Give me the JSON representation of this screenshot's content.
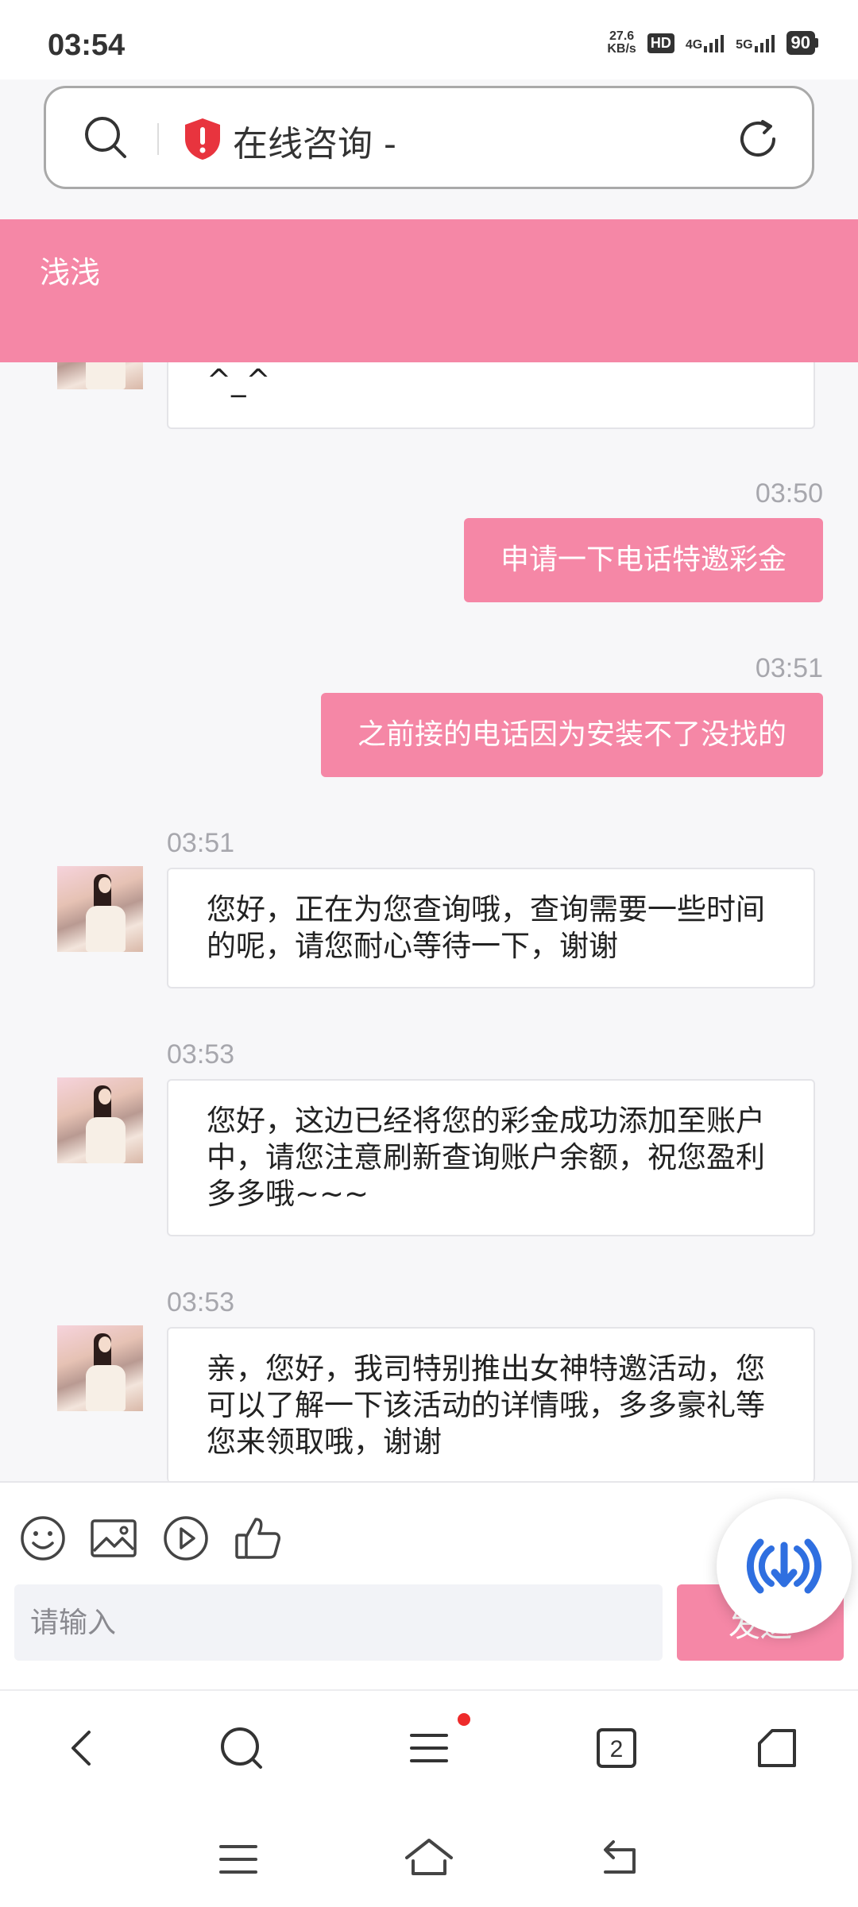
{
  "status_bar": {
    "time": "03:54",
    "net_speed_value": "27.6",
    "net_speed_unit": "KB/s",
    "hd_badge": "HD",
    "sim1_label": "4G",
    "sim2_label": "5G",
    "battery": "90"
  },
  "browser": {
    "page_title": "在线咨询 -",
    "tab_count": "2"
  },
  "chat": {
    "agent_name": "浅浅",
    "partial_message": "^_^",
    "messages": [
      {
        "time": "03:50",
        "text": "申请一下电话特邀彩金"
      },
      {
        "time": "03:51",
        "text": "之前接的电话因为安装不了没找的"
      },
      {
        "time": "03:51",
        "text": "您好，正在为您查询哦，查询需要一些时间的呢，请您耐心等待一下，谢谢"
      },
      {
        "time": "03:53",
        "text": "您好，这边已经将您的彩金成功添加至账户中，请您注意刷新查询账户余额，祝您盈利多多哦~~~"
      },
      {
        "time": "03:53",
        "text": "亲，您好，我司特别推出女神特邀活动，您可以了解一下该活动的详情哦，多多豪礼等您来领取哦，谢谢"
      }
    ]
  },
  "composer": {
    "placeholder": "请输入",
    "send_label": "发送",
    "tools": [
      "emoji-icon",
      "image-icon",
      "video-icon",
      "thumbs-up-icon"
    ]
  },
  "colors": {
    "accent": "#f587a6",
    "download_blue": "#2f6fe0"
  }
}
